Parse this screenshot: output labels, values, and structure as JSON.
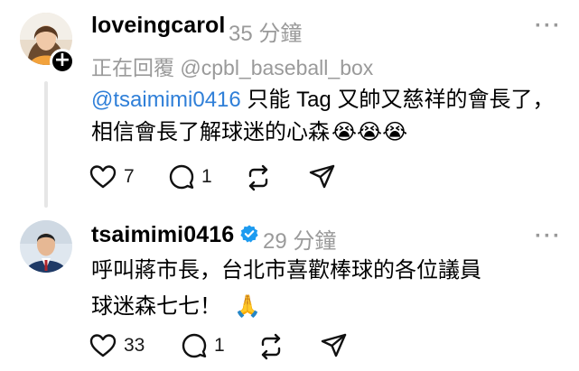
{
  "posts": [
    {
      "username": "loveingcarol",
      "time": "35 分鐘",
      "more_label": "···",
      "replying_to": "正在回覆 @cpbl_baseball_box",
      "mention": "@tsaimimi0416",
      "text_line1": " 只能 Tag 又帥又慈祥的會長了，",
      "text_line2": "相信會長了解球迷的心森",
      "emoji": "😭😭😭",
      "likes": "7",
      "comments": "1",
      "verified": false
    },
    {
      "username": "tsaimimi0416",
      "time": "29 分鐘",
      "more_label": "···",
      "text_line1": "呼叫蔣市長，台北市喜歡棒球的各位議員",
      "text_line2": "球迷森七七！",
      "emoji": "🙏",
      "likes": "33",
      "comments": "1",
      "verified": true
    }
  ],
  "colors": {
    "mention": "#2f7fd8",
    "muted": "#9a9a9a",
    "verified": "#1d9bf0"
  },
  "icons": [
    "heart-icon",
    "comment-icon",
    "repost-icon",
    "share-icon",
    "verified-icon",
    "plus-icon",
    "more-icon"
  ]
}
